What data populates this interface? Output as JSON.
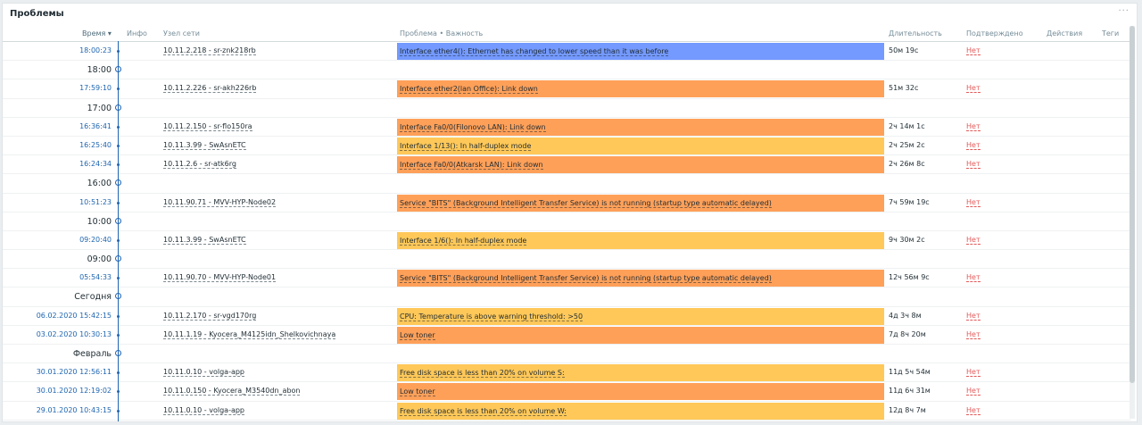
{
  "panel": {
    "title": "Проблемы",
    "menu": "···"
  },
  "columns": {
    "time": "Время ▾",
    "info": "Инфо",
    "host": "Узел сети",
    "problem": "Проблема • Важность",
    "duration": "Длительность",
    "ack": "Подтверждено",
    "actions": "Действия",
    "tags": "Теги"
  },
  "colors": {
    "information": "#7499ff",
    "average": "#ffa059",
    "warning": "#ffc859",
    "ack_no": "#e45959",
    "link": "#1f65b0"
  },
  "rows": [
    {
      "type": "problem",
      "time": "18:00:23",
      "host": "10.11.2.218 - sr-znk218rb",
      "problem": "Interface ether4(): Ethernet has changed to lower speed than it was before",
      "severity": "information",
      "duration": "50м 19с",
      "ack": "Нет"
    },
    {
      "type": "section",
      "label": "18:00"
    },
    {
      "type": "problem",
      "time": "17:59:10",
      "host": "10.11.2.226 - sr-akh226rb",
      "problem": "Interface ether2(lan Office): Link down",
      "severity": "average",
      "duration": "51м 32с",
      "ack": "Нет"
    },
    {
      "type": "section",
      "label": "17:00"
    },
    {
      "type": "problem",
      "time": "16:36:41",
      "host": "10.11.2.150 - sr-flo150ra",
      "problem": "Interface Fa0/0(Filonovo LAN): Link down",
      "severity": "average",
      "duration": "2ч 14м 1с",
      "ack": "Нет"
    },
    {
      "type": "problem",
      "time": "16:25:40",
      "host": "10.11.3.99 - SwAsnETC",
      "problem": "Interface 1/13(): In half-duplex mode",
      "severity": "warning",
      "duration": "2ч 25м 2с",
      "ack": "Нет"
    },
    {
      "type": "problem",
      "time": "16:24:34",
      "host": "10.11.2.6 - sr-atk6rg",
      "problem": "Interface Fa0/0(Atkarsk LAN): Link down",
      "severity": "average",
      "duration": "2ч 26м 8с",
      "ack": "Нет"
    },
    {
      "type": "section",
      "label": "16:00"
    },
    {
      "type": "problem",
      "time": "10:51:23",
      "host": "10.11.90.71 - MVV-HYP-Node02",
      "problem": "Service \"BITS\" (Background Intelligent Transfer Service) is not running (startup type automatic delayed)",
      "severity": "average",
      "duration": "7ч 59м 19с",
      "ack": "Нет"
    },
    {
      "type": "section",
      "label": "10:00"
    },
    {
      "type": "problem",
      "time": "09:20:40",
      "host": "10.11.3.99 - SwAsnETC",
      "problem": "Interface 1/6(): In half-duplex mode",
      "severity": "warning",
      "duration": "9ч 30м 2с",
      "ack": "Нет"
    },
    {
      "type": "section",
      "label": "09:00"
    },
    {
      "type": "problem",
      "time": "05:54:33",
      "host": "10.11.90.70 - MVV-HYP-Node01",
      "problem": "Service \"BITS\" (Background Intelligent Transfer Service) is not running (startup type automatic delayed)",
      "severity": "average",
      "duration": "12ч 56м 9с",
      "ack": "Нет"
    },
    {
      "type": "section",
      "label": "Сегодня"
    },
    {
      "type": "problem",
      "time": "06.02.2020 15:42:15",
      "host": "10.11.2.170 - sr-vgd170rg",
      "problem": "CPU: Temperature is above warning threshold: >50",
      "severity": "warning",
      "duration": "4д 3ч 8м",
      "ack": "Нет"
    },
    {
      "type": "problem",
      "time": "03.02.2020 10:30:13",
      "host": "10.11.1.19 - Kyocera_M4125idn_Shelkovichnaya",
      "problem": "Low toner",
      "severity": "average",
      "duration": "7д 8ч 20м",
      "ack": "Нет"
    },
    {
      "type": "section",
      "label": "Февраль"
    },
    {
      "type": "problem",
      "time": "30.01.2020 12:56:11",
      "host": "10.11.0.10 - volga-app",
      "problem": "Free disk space is less than 20% on volume S:",
      "severity": "warning",
      "duration": "11д 5ч 54м",
      "ack": "Нет"
    },
    {
      "type": "problem",
      "time": "30.01.2020 12:19:02",
      "host": "10.11.0.150 - Kyocera_M3540dn_abon",
      "problem": "Low toner",
      "severity": "average",
      "duration": "11д 6ч 31м",
      "ack": "Нет"
    },
    {
      "type": "problem",
      "time": "29.01.2020 10:43:15",
      "host": "10.11.0.10 - volga-app",
      "problem": "Free disk space is less than 20% on volume W:",
      "severity": "warning",
      "duration": "12д 8ч 7м",
      "ack": "Нет"
    }
  ]
}
